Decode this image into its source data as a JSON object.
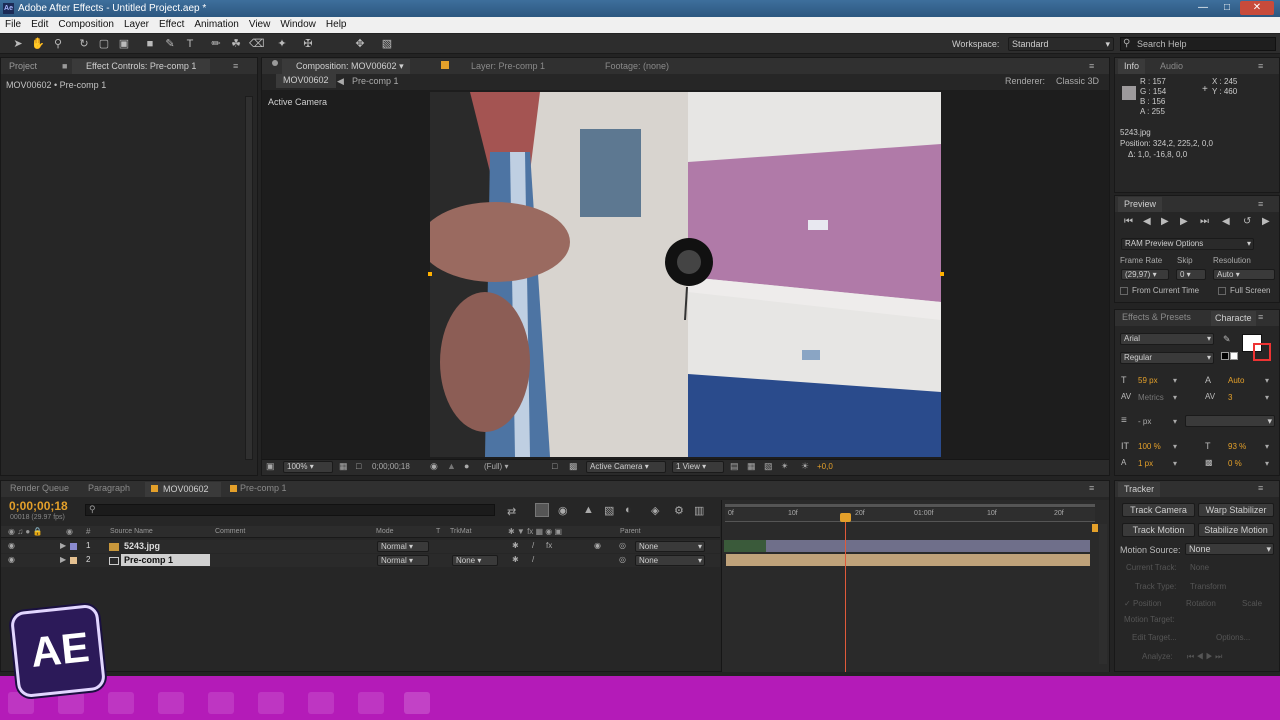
{
  "window": {
    "title": "Adobe After Effects - Untitled Project.aep *",
    "app_icon": "Ae"
  },
  "menu": [
    "File",
    "Edit",
    "Composition",
    "Layer",
    "Effect",
    "Animation",
    "View",
    "Window",
    "Help"
  ],
  "toolbar": {
    "workspace_label": "Workspace:",
    "workspace_value": "Standard",
    "search_placeholder": "Search Help"
  },
  "project_panel": {
    "tab_project": "Project",
    "tab_effect_controls": "Effect Controls: Pre-comp 1",
    "breadcrumb": "MOV00602 • Pre-comp 1"
  },
  "comp_panel": {
    "tab_composition": "Composition: MOV00602",
    "tab_layer": "Layer: Pre-comp 1",
    "tab_footage": "Footage: (none)",
    "sub_tab_1": "MOV00602",
    "sub_tab_2": "Pre-comp 1",
    "renderer_label": "Renderer:",
    "renderer_value": "Classic 3D",
    "active_camera": "Active Camera",
    "zoom": "100%",
    "timecode": "0;00;00;18",
    "resolution": "(Full)",
    "view_camera": "Active Camera",
    "views": "1 View",
    "exposure": "+0,0"
  },
  "info_panel": {
    "tab_info": "Info",
    "tab_audio": "Audio",
    "r": "R : 157",
    "g": "G : 154",
    "b": "B : 156",
    "a": "A : 255",
    "x": "X : 245",
    "y": "Y : 460",
    "layer_name": "5243.jpg",
    "position": "Position: 324,2, 225,2, 0,0",
    "delta": "Δ: 1,0, -16,8, 0,0"
  },
  "preview_panel": {
    "title": "Preview",
    "ram_options": "RAM Preview Options",
    "frame_rate_label": "Frame Rate",
    "skip_label": "Skip",
    "resolution_label": "Resolution",
    "frame_rate_value": "(29,97)",
    "skip_value": "0",
    "resolution_value": "Auto",
    "from_current": "From Current Time",
    "full_screen": "Full Screen"
  },
  "character_panel": {
    "tab_effects": "Effects & Presets",
    "tab_character": "Characte",
    "font": "Arial",
    "style": "Regular",
    "font_size": "59 px",
    "leading": "Auto",
    "kerning": "Metrics",
    "tracking": "3",
    "stroke": "- px",
    "vscale": "100 %",
    "hscale": "93 %",
    "baseline": "1 px",
    "tsume": "0 %"
  },
  "timeline": {
    "tab_render": "Render Queue",
    "tab_paragraph": "Paragraph",
    "tab_comp": "MOV00602",
    "tab_precomp": "Pre-comp 1",
    "timecode": "0;00;00;18",
    "timecode_sub": "00018 (29.97 fps)",
    "columns": {
      "source": "Source Name",
      "comment": "Comment",
      "mode": "Mode",
      "t": "T",
      "trkmat": "TrkMat",
      "parent": "Parent"
    },
    "ruler": [
      "0f",
      "10f",
      "20f",
      "01:00f",
      "10f",
      "20f"
    ],
    "layers": [
      {
        "num": "1",
        "name": "5243.jpg",
        "mode": "Normal",
        "trkmat": "",
        "parent": "None"
      },
      {
        "num": "2",
        "name": "Pre-comp 1",
        "mode": "Normal",
        "trkmat": "None",
        "parent": "None"
      }
    ]
  },
  "tracker_panel": {
    "title": "Tracker",
    "track_camera": "Track Camera",
    "warp_stabilizer": "Warp Stabilizer",
    "track_motion": "Track Motion",
    "stabilize_motion": "Stabilize Motion",
    "motion_source_label": "Motion Source:",
    "motion_source_value": "None",
    "current_track": "Current Track:",
    "current_track_value": "None",
    "track_type": "Track Type:",
    "track_type_value": "Transform",
    "position": "Position",
    "rotation": "Rotation",
    "scale": "Scale",
    "motion_target": "Motion Target:",
    "edit_target": "Edit Target...",
    "options": "Options...",
    "analyze": "Analyze:"
  },
  "logo": "AE",
  "colors": {
    "accent": "#e4a02a",
    "taskbar": "#b41bb8",
    "wall_purple": "#b07aa8",
    "wall_blue": "#2a4b8c"
  }
}
